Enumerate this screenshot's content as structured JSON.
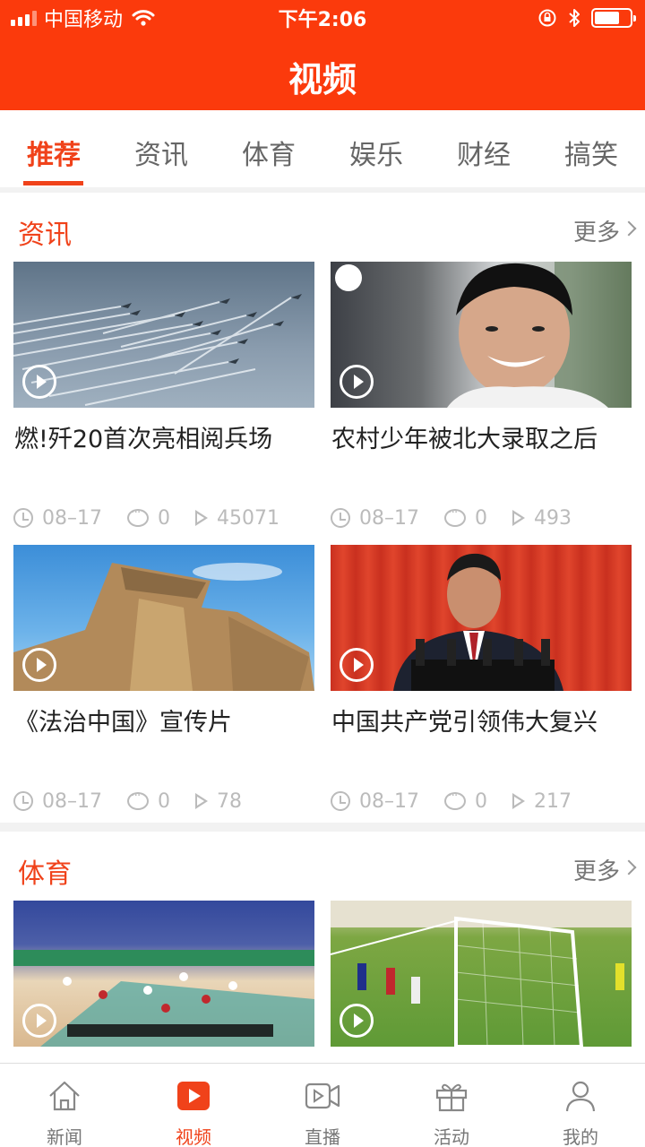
{
  "status": {
    "carrier": "中国移动",
    "time": "下午2:06"
  },
  "header": {
    "title": "视频"
  },
  "tabs": [
    "推荐",
    "资讯",
    "体育",
    "娱乐",
    "财经",
    "搞笑"
  ],
  "sections": [
    {
      "title": "资讯",
      "more": "更多",
      "cards": [
        {
          "title": "燃!歼20首次亮相阅兵场",
          "date": "08–17",
          "comments": "0",
          "plays": "45071"
        },
        {
          "title": "农村少年被北大录取之后",
          "date": "08–17",
          "comments": "0",
          "plays": "493"
        },
        {
          "title": "《法治中国》宣传片",
          "date": "08–17",
          "comments": "0",
          "plays": "78"
        },
        {
          "title": "中国共产党引领伟大复兴",
          "date": "08–17",
          "comments": "0",
          "plays": "217"
        }
      ]
    },
    {
      "title": "体育",
      "more": "更多",
      "cards": [
        {},
        {}
      ]
    }
  ],
  "bottom_tabs": [
    {
      "label": "新闻",
      "icon": "home-icon"
    },
    {
      "label": "视频",
      "icon": "video-play-icon"
    },
    {
      "label": "直播",
      "icon": "live-camera-icon"
    },
    {
      "label": "活动",
      "icon": "gift-icon"
    },
    {
      "label": "我的",
      "icon": "user-icon"
    }
  ],
  "colors": {
    "brand": "#fb3a0c",
    "accent": "#f0421a"
  }
}
